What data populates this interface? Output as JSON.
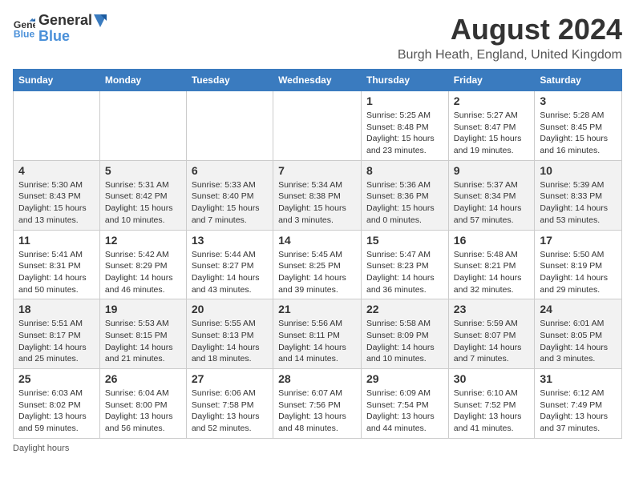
{
  "logo": {
    "general": "General",
    "blue": "Blue"
  },
  "title": "August 2024",
  "location": "Burgh Heath, England, United Kingdom",
  "days_of_week": [
    "Sunday",
    "Monday",
    "Tuesday",
    "Wednesday",
    "Thursday",
    "Friday",
    "Saturday"
  ],
  "footer": "Daylight hours",
  "weeks": [
    [
      {
        "day": "",
        "info": ""
      },
      {
        "day": "",
        "info": ""
      },
      {
        "day": "",
        "info": ""
      },
      {
        "day": "",
        "info": ""
      },
      {
        "day": "1",
        "info": "Sunrise: 5:25 AM\nSunset: 8:48 PM\nDaylight: 15 hours and 23 minutes."
      },
      {
        "day": "2",
        "info": "Sunrise: 5:27 AM\nSunset: 8:47 PM\nDaylight: 15 hours and 19 minutes."
      },
      {
        "day": "3",
        "info": "Sunrise: 5:28 AM\nSunset: 8:45 PM\nDaylight: 15 hours and 16 minutes."
      }
    ],
    [
      {
        "day": "4",
        "info": "Sunrise: 5:30 AM\nSunset: 8:43 PM\nDaylight: 15 hours and 13 minutes."
      },
      {
        "day": "5",
        "info": "Sunrise: 5:31 AM\nSunset: 8:42 PM\nDaylight: 15 hours and 10 minutes."
      },
      {
        "day": "6",
        "info": "Sunrise: 5:33 AM\nSunset: 8:40 PM\nDaylight: 15 hours and 7 minutes."
      },
      {
        "day": "7",
        "info": "Sunrise: 5:34 AM\nSunset: 8:38 PM\nDaylight: 15 hours and 3 minutes."
      },
      {
        "day": "8",
        "info": "Sunrise: 5:36 AM\nSunset: 8:36 PM\nDaylight: 15 hours and 0 minutes."
      },
      {
        "day": "9",
        "info": "Sunrise: 5:37 AM\nSunset: 8:34 PM\nDaylight: 14 hours and 57 minutes."
      },
      {
        "day": "10",
        "info": "Sunrise: 5:39 AM\nSunset: 8:33 PM\nDaylight: 14 hours and 53 minutes."
      }
    ],
    [
      {
        "day": "11",
        "info": "Sunrise: 5:41 AM\nSunset: 8:31 PM\nDaylight: 14 hours and 50 minutes."
      },
      {
        "day": "12",
        "info": "Sunrise: 5:42 AM\nSunset: 8:29 PM\nDaylight: 14 hours and 46 minutes."
      },
      {
        "day": "13",
        "info": "Sunrise: 5:44 AM\nSunset: 8:27 PM\nDaylight: 14 hours and 43 minutes."
      },
      {
        "day": "14",
        "info": "Sunrise: 5:45 AM\nSunset: 8:25 PM\nDaylight: 14 hours and 39 minutes."
      },
      {
        "day": "15",
        "info": "Sunrise: 5:47 AM\nSunset: 8:23 PM\nDaylight: 14 hours and 36 minutes."
      },
      {
        "day": "16",
        "info": "Sunrise: 5:48 AM\nSunset: 8:21 PM\nDaylight: 14 hours and 32 minutes."
      },
      {
        "day": "17",
        "info": "Sunrise: 5:50 AM\nSunset: 8:19 PM\nDaylight: 14 hours and 29 minutes."
      }
    ],
    [
      {
        "day": "18",
        "info": "Sunrise: 5:51 AM\nSunset: 8:17 PM\nDaylight: 14 hours and 25 minutes."
      },
      {
        "day": "19",
        "info": "Sunrise: 5:53 AM\nSunset: 8:15 PM\nDaylight: 14 hours and 21 minutes."
      },
      {
        "day": "20",
        "info": "Sunrise: 5:55 AM\nSunset: 8:13 PM\nDaylight: 14 hours and 18 minutes."
      },
      {
        "day": "21",
        "info": "Sunrise: 5:56 AM\nSunset: 8:11 PM\nDaylight: 14 hours and 14 minutes."
      },
      {
        "day": "22",
        "info": "Sunrise: 5:58 AM\nSunset: 8:09 PM\nDaylight: 14 hours and 10 minutes."
      },
      {
        "day": "23",
        "info": "Sunrise: 5:59 AM\nSunset: 8:07 PM\nDaylight: 14 hours and 7 minutes."
      },
      {
        "day": "24",
        "info": "Sunrise: 6:01 AM\nSunset: 8:05 PM\nDaylight: 14 hours and 3 minutes."
      }
    ],
    [
      {
        "day": "25",
        "info": "Sunrise: 6:03 AM\nSunset: 8:02 PM\nDaylight: 13 hours and 59 minutes."
      },
      {
        "day": "26",
        "info": "Sunrise: 6:04 AM\nSunset: 8:00 PM\nDaylight: 13 hours and 56 minutes."
      },
      {
        "day": "27",
        "info": "Sunrise: 6:06 AM\nSunset: 7:58 PM\nDaylight: 13 hours and 52 minutes."
      },
      {
        "day": "28",
        "info": "Sunrise: 6:07 AM\nSunset: 7:56 PM\nDaylight: 13 hours and 48 minutes."
      },
      {
        "day": "29",
        "info": "Sunrise: 6:09 AM\nSunset: 7:54 PM\nDaylight: 13 hours and 44 minutes."
      },
      {
        "day": "30",
        "info": "Sunrise: 6:10 AM\nSunset: 7:52 PM\nDaylight: 13 hours and 41 minutes."
      },
      {
        "day": "31",
        "info": "Sunrise: 6:12 AM\nSunset: 7:49 PM\nDaylight: 13 hours and 37 minutes."
      }
    ]
  ]
}
